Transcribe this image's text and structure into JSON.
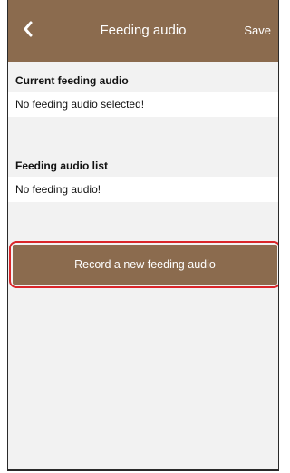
{
  "header": {
    "back_icon": "chevron-left-icon",
    "title": "Feeding audio",
    "save_label": "Save"
  },
  "current_section": {
    "label": "Current feeding audio",
    "value": "No feeding audio selected!"
  },
  "list_section": {
    "label": "Feeding audio list",
    "value": "No feeding audio!"
  },
  "record_button": {
    "label": "Record a new feeding audio"
  },
  "colors": {
    "brand_brown": "#8b6b4e",
    "highlight_red": "#d9262a"
  }
}
